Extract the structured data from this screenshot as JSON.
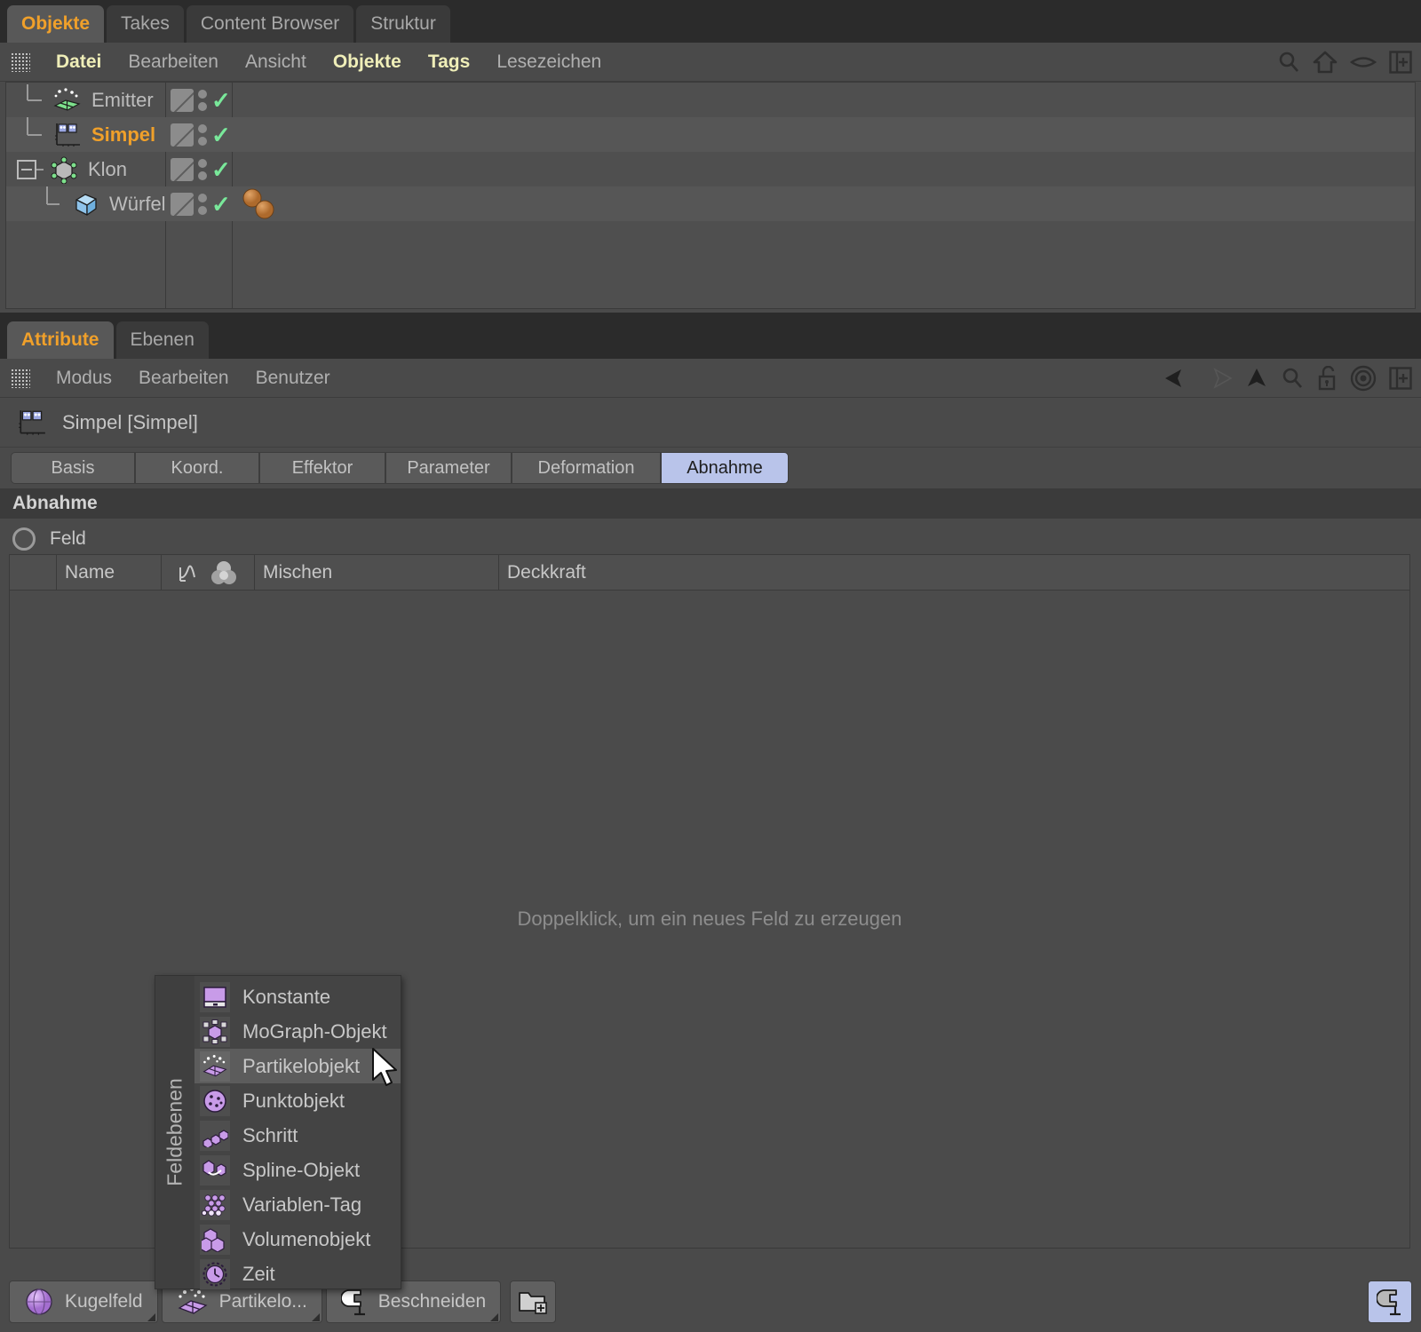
{
  "object_manager": {
    "tabs": [
      {
        "label": "Objekte",
        "active": true
      },
      {
        "label": "Takes",
        "active": false
      },
      {
        "label": "Content Browser",
        "active": false
      },
      {
        "label": "Struktur",
        "active": false
      }
    ],
    "menu": [
      {
        "label": "Datei",
        "highlight": true
      },
      {
        "label": "Bearbeiten",
        "highlight": false
      },
      {
        "label": "Ansicht",
        "highlight": false
      },
      {
        "label": "Objekte",
        "highlight": true
      },
      {
        "label": "Tags",
        "highlight": true
      },
      {
        "label": "Lesezeichen",
        "highlight": false
      }
    ],
    "toolbar_icons": [
      "search-icon",
      "home-icon",
      "eye-icon",
      "panel-icon"
    ],
    "tree": [
      {
        "name": "Emitter",
        "icon": "emitter-icon",
        "indent": 1,
        "selected": false,
        "expander": "none",
        "tags": 0
      },
      {
        "name": "Simpel",
        "icon": "simple-effector-icon",
        "indent": 1,
        "selected": true,
        "expander": "none",
        "tags": 0
      },
      {
        "name": "Klon",
        "icon": "cloner-icon",
        "indent": 1,
        "selected": false,
        "expander": "minus",
        "tags": 0
      },
      {
        "name": "Würfel",
        "icon": "cube-icon",
        "indent": 2,
        "selected": false,
        "expander": "none",
        "tags": 2
      }
    ]
  },
  "attribute_manager": {
    "tabs": [
      {
        "label": "Attribute",
        "active": true
      },
      {
        "label": "Ebenen",
        "active": false
      }
    ],
    "menu": [
      {
        "label": "Modus",
        "highlight": false
      },
      {
        "label": "Bearbeiten",
        "highlight": false
      },
      {
        "label": "Benutzer",
        "highlight": false
      }
    ],
    "toolbar_icons": [
      "back-arrow-icon",
      "forward-arrow-icon",
      "up-arrow-icon",
      "search-icon",
      "unlock-icon",
      "target-icon",
      "panel-icon"
    ],
    "object_title": "Simpel [Simpel]",
    "object_icon": "simple-effector-icon",
    "mode_tabs": [
      {
        "label": "Basis",
        "active": false
      },
      {
        "label": "Koord.",
        "active": false
      },
      {
        "label": "Effektor",
        "active": false
      },
      {
        "label": "Parameter",
        "active": false
      },
      {
        "label": "Deformation",
        "active": false
      },
      {
        "label": "Abnahme",
        "active": true
      }
    ],
    "section_title": "Abnahme",
    "field_toggle_label": "Feld",
    "field_list": {
      "columns": [
        "",
        "Name",
        "",
        "Mischen",
        "Deckkraft"
      ],
      "rows": [],
      "empty_hint": "Doppelklick, um ein neues Feld zu erzeugen"
    },
    "bottom_bar": {
      "presets": [
        {
          "label": "Kugelfeld",
          "icon": "sphere-field-icon"
        },
        {
          "label": "Partikelo...",
          "icon": "particle-object-icon"
        },
        {
          "label": "Beschneiden",
          "icon": "clamp-icon"
        }
      ],
      "folder_button": "folder-add-icon",
      "clamp_toggle": "clamp-icon"
    }
  },
  "dropdown": {
    "group_label": "Feldebenen",
    "items": [
      {
        "label": "Konstante",
        "icon": "constant-icon",
        "hover": false
      },
      {
        "label": "MoGraph-Objekt",
        "icon": "mograph-object-icon",
        "hover": false
      },
      {
        "label": "Partikelobjekt",
        "icon": "particle-object-icon",
        "hover": true
      },
      {
        "label": "Punktobjekt",
        "icon": "point-object-icon",
        "hover": false
      },
      {
        "label": "Schritt",
        "icon": "step-icon",
        "hover": false
      },
      {
        "label": "Spline-Objekt",
        "icon": "spline-object-icon",
        "hover": false
      },
      {
        "label": "Variablen-Tag",
        "icon": "variable-tag-icon",
        "hover": false
      },
      {
        "label": "Volumenobjekt",
        "icon": "volume-object-icon",
        "hover": false
      },
      {
        "label": "Zeit",
        "icon": "time-icon",
        "hover": false
      }
    ]
  },
  "colors": {
    "accent_orange": "#f0a02a",
    "accent_menu": "#efeeb8",
    "selection_blue": "#b9c4ea",
    "check_green": "#79e89a",
    "icon_purple": "#c89be8",
    "tag_brown": "#c07a3a"
  }
}
